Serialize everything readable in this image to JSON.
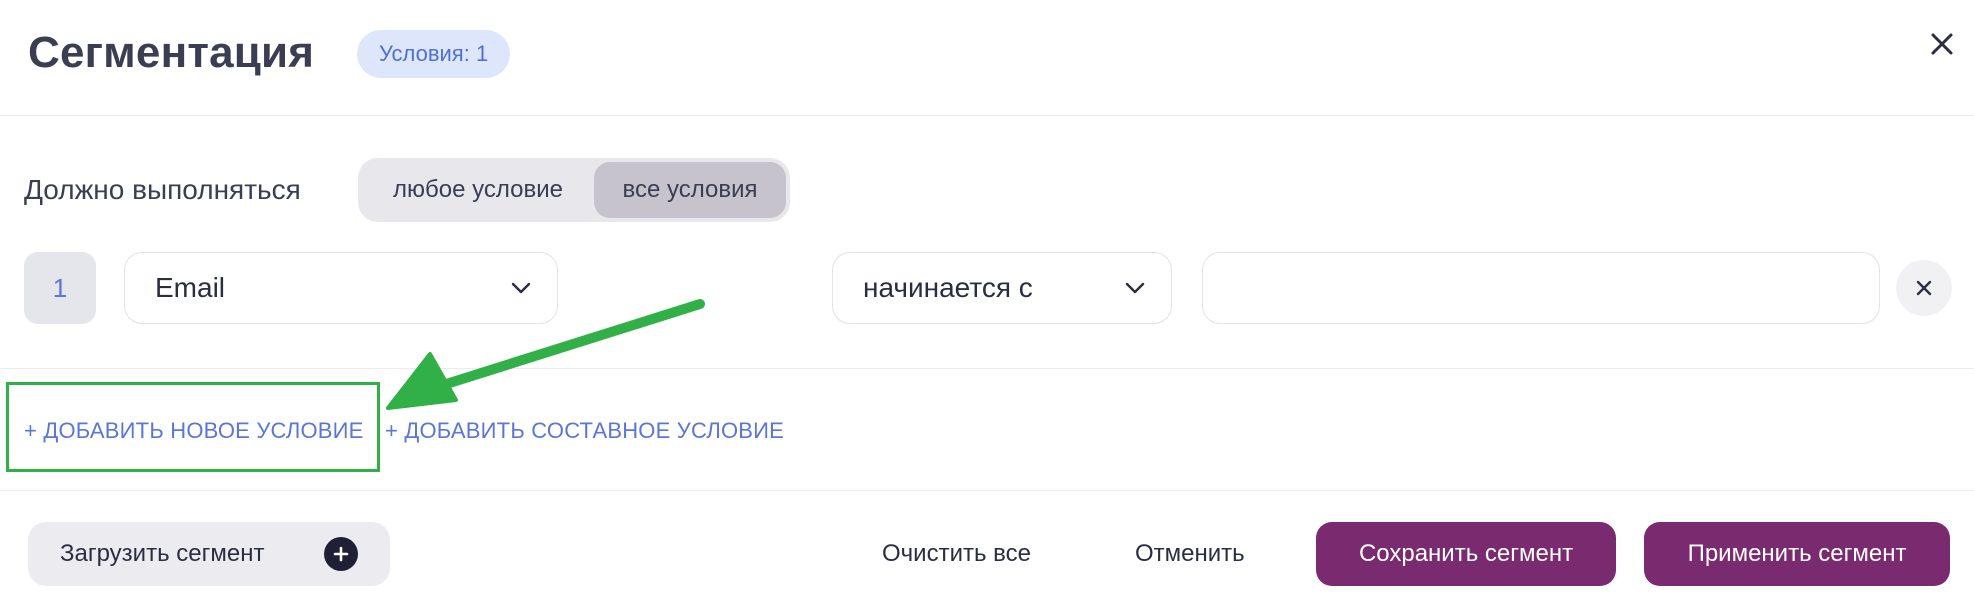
{
  "header": {
    "title": "Сегментация",
    "conditions_badge": "Условия: 1",
    "close_icon": "close-icon"
  },
  "match_mode": {
    "label": "Должно выполняться",
    "options": [
      {
        "label": "любое условие",
        "selected": false
      },
      {
        "label": "все условия",
        "selected": true
      }
    ]
  },
  "conditions": [
    {
      "index": "1",
      "field": "Email",
      "operator": "начинается с",
      "value": ""
    }
  ],
  "actions": {
    "add_condition": "+ ДОБАВИТЬ НОВОЕ УСЛОВИЕ",
    "add_compound_condition": "+ ДОБАВИТЬ СОСТАВНОЕ УСЛОВИЕ"
  },
  "footer": {
    "load_segment": "Загрузить сегмент",
    "clear_all": "Очистить все",
    "cancel": "Отменить",
    "save_segment": "Сохранить сегмент",
    "apply_segment": "Применить сегмент"
  },
  "colors": {
    "accent": "#7a2a6e",
    "link": "#5b76d8",
    "badge_bg": "#dde6fb",
    "highlight": "#31b047"
  }
}
